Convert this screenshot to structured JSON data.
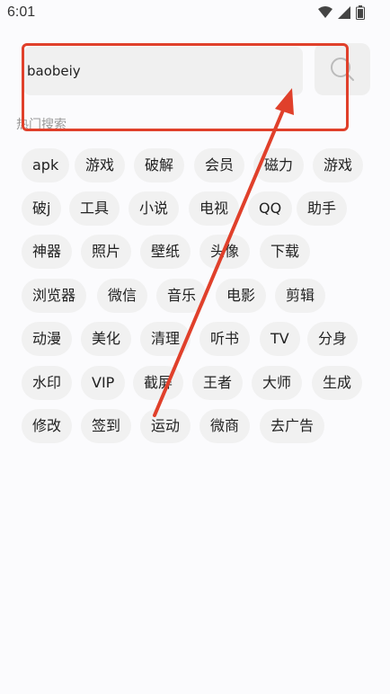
{
  "status_bar": {
    "time": "6:01",
    "icons": [
      "wifi-icon",
      "signal-icon",
      "battery-icon"
    ]
  },
  "search": {
    "value": "baobeiy",
    "button_icon": "search-icon"
  },
  "hot_search": {
    "title": "热门搜索",
    "rows": [
      [
        "apk",
        "游戏",
        "破解",
        "会员",
        "磁力",
        "游戏"
      ],
      [
        "破j",
        "工具",
        "小说",
        "电视",
        "QQ",
        "助手"
      ],
      [
        "神器",
        "照片",
        "壁纸",
        "头像",
        "下载"
      ],
      [
        "浏览器",
        "微信",
        "音乐",
        "电影",
        "剪辑"
      ],
      [
        "动漫",
        "美化",
        "清理",
        "听书",
        "TV",
        "分身"
      ],
      [
        "水印",
        "VIP",
        "截屏",
        "王者",
        "大师",
        "生成"
      ],
      [
        "修改",
        "签到",
        "运动",
        "微商",
        "去广告"
      ]
    ]
  },
  "annotation": {
    "color": "#e0402b"
  }
}
